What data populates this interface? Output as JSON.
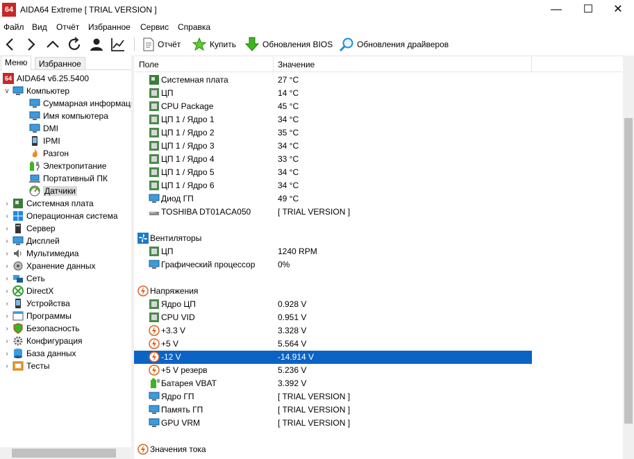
{
  "window": {
    "logo": "64",
    "title": "AIDA64 Extreme  [ TRIAL VERSION ]",
    "minimize": "—",
    "maximize": "☐",
    "close": "✕"
  },
  "menu": [
    "Файл",
    "Вид",
    "Отчёт",
    "Избранное",
    "Сервис",
    "Справка"
  ],
  "toolbar": {
    "report": "Отчёт",
    "buy": "Купить",
    "bios_updates": "Обновления BIOS",
    "driver_updates": "Обновления драйверов"
  },
  "tabs": {
    "menu": "Меню",
    "favorites": "Избранное"
  },
  "tree": {
    "root": "AIDA64 v6.25.5400",
    "computer": "Компьютер",
    "computer_children": [
      "Суммарная информация",
      "Имя компьютера",
      "DMI",
      "IPMI",
      "Разгон",
      "Электропитание",
      "Портативный ПК",
      "Датчики"
    ],
    "categories": [
      "Системная плата",
      "Операционная система",
      "Сервер",
      "Дисплей",
      "Мультимедиа",
      "Хранение данных",
      "Сеть",
      "DirectX",
      "Устройства",
      "Программы",
      "Безопасность",
      "Конфигурация",
      "База данных",
      "Тесты"
    ]
  },
  "columns": {
    "field": "Поле",
    "value": "Значение"
  },
  "temps": [
    {
      "name": "Системная плата",
      "value": "27 °C"
    },
    {
      "name": "ЦП",
      "value": "14 °C"
    },
    {
      "name": "CPU Package",
      "value": "45 °C"
    },
    {
      "name": "ЦП 1 / Ядро 1",
      "value": "34 °C"
    },
    {
      "name": "ЦП 1 / Ядро 2",
      "value": "35 °C"
    },
    {
      "name": "ЦП 1 / Ядро 3",
      "value": "34 °C"
    },
    {
      "name": "ЦП 1 / Ядро 4",
      "value": "33 °C"
    },
    {
      "name": "ЦП 1 / Ядро 5",
      "value": "34 °C"
    },
    {
      "name": "ЦП 1 / Ядро 6",
      "value": "34 °C"
    },
    {
      "name": "Диод ГП",
      "value": "49 °C"
    },
    {
      "name": "TOSHIBA DT01ACA050",
      "value": "[ TRIAL VERSION ]"
    }
  ],
  "fans_title": "Вентиляторы",
  "fans": [
    {
      "name": "ЦП",
      "value": "1240 RPM"
    },
    {
      "name": "Графический процессор",
      "value": "0%"
    }
  ],
  "voltages_title": "Напряжения",
  "voltages": [
    {
      "name": "Ядро ЦП",
      "value": "0.928 V"
    },
    {
      "name": "CPU VID",
      "value": "0.951 V"
    },
    {
      "name": "+3.3 V",
      "value": "3.328 V"
    },
    {
      "name": "+5 V",
      "value": "5.564 V"
    },
    {
      "name": "-12 V",
      "value": "-14.914 V"
    },
    {
      "name": "+5 V резерв",
      "value": "5.236 V"
    },
    {
      "name": "Батарея VBAT",
      "value": "3.392 V"
    },
    {
      "name": "Ядро ГП",
      "value": "[ TRIAL VERSION ]"
    },
    {
      "name": "Память ГП",
      "value": "[ TRIAL VERSION ]"
    },
    {
      "name": "GPU VRM",
      "value": "[ TRIAL VERSION ]"
    }
  ],
  "current_title": "Значения тока",
  "colors": {
    "selection": "#0b63c6",
    "logo": "#c62828"
  }
}
